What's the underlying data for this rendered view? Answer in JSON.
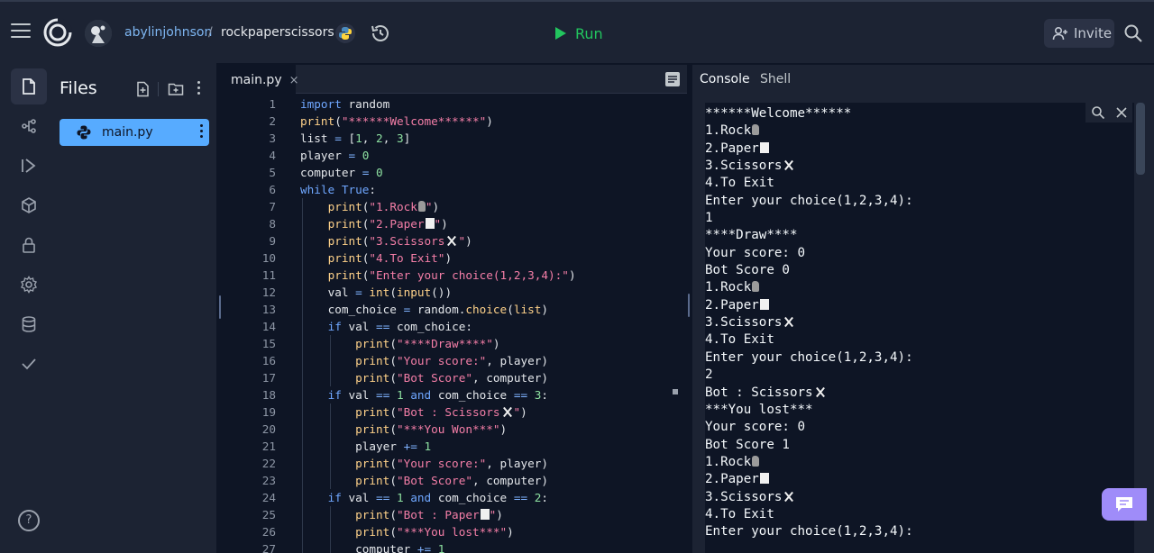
{
  "header": {
    "username": "abylinjohnson",
    "separator": "/",
    "repl_name": "rockpaperscissors",
    "run_label": "Run",
    "invite_label": "Invite"
  },
  "files_panel": {
    "title": "Files",
    "files": [
      {
        "name": "main.py"
      }
    ]
  },
  "editor": {
    "tab_label": "main.py",
    "tab_close": "×",
    "line_numbers": [
      "1",
      "2",
      "3",
      "4",
      "5",
      "6",
      "7",
      "8",
      "9",
      "10",
      "11",
      "12",
      "13",
      "14",
      "15",
      "16",
      "17",
      "18",
      "19",
      "20",
      "21",
      "22",
      "23",
      "24",
      "25",
      "26",
      "27"
    ],
    "lines": [
      "import random",
      "print(\"******Welcome******\")",
      "list = [1, 2, 3]",
      "player = 0",
      "computer = 0",
      "while True:",
      "    print(\"1.Rock\")",
      "    print(\"2.Paper\")",
      "    print(\"3.Scissors\")",
      "    print(\"4.To Exit\")",
      "    print(\"Enter your choice(1,2,3,4):\")",
      "    val = int(input())",
      "    com_choice = random.choice(list)",
      "    if val == com_choice:",
      "        print(\"****Draw****\")",
      "        print(\"Your score:\", player)",
      "        print(\"Bot Score\", computer)",
      "    if val == 1 and com_choice == 3:",
      "        print(\"Bot : Scissors\")",
      "        print(\"***You Won***\")",
      "        player += 1",
      "        print(\"Your score:\", player)",
      "        print(\"Bot Score\", computer)",
      "    if val == 1 and com_choice == 2:",
      "        print(\"Bot : Paper\")",
      "        print(\"***You lost***\")",
      "        computer += 1"
    ]
  },
  "console": {
    "tabs": [
      {
        "label": "Console",
        "active": true
      },
      {
        "label": "Shell",
        "active": false
      }
    ],
    "output": [
      {
        "text": "******Welcome******",
        "emoji": ""
      },
      {
        "text": "1.Rock",
        "emoji": "rock"
      },
      {
        "text": "2.Paper",
        "emoji": "paper"
      },
      {
        "text": "3.Scissors",
        "emoji": "scissors"
      },
      {
        "text": "4.To Exit",
        "emoji": ""
      },
      {
        "text": "Enter your choice(1,2,3,4):",
        "emoji": ""
      },
      {
        "text": "1",
        "emoji": ""
      },
      {
        "text": "****Draw****",
        "emoji": ""
      },
      {
        "text": "Your score: 0",
        "emoji": ""
      },
      {
        "text": "Bot Score 0",
        "emoji": ""
      },
      {
        "text": "1.Rock",
        "emoji": "rock"
      },
      {
        "text": "2.Paper",
        "emoji": "paper"
      },
      {
        "text": "3.Scissors",
        "emoji": "scissors"
      },
      {
        "text": "4.To Exit",
        "emoji": ""
      },
      {
        "text": "Enter your choice(1,2,3,4):",
        "emoji": ""
      },
      {
        "text": "2",
        "emoji": ""
      },
      {
        "text": "Bot : Scissors",
        "emoji": "scissors"
      },
      {
        "text": "***You lost***",
        "emoji": ""
      },
      {
        "text": "Your score: 0",
        "emoji": ""
      },
      {
        "text": "Bot Score 1",
        "emoji": ""
      },
      {
        "text": "1.Rock",
        "emoji": "rock"
      },
      {
        "text": "2.Paper",
        "emoji": "paper"
      },
      {
        "text": "3.Scissors",
        "emoji": "scissors"
      },
      {
        "text": "4.To Exit",
        "emoji": ""
      },
      {
        "text": "Enter your choice(1,2,3,4):",
        "emoji": ""
      }
    ]
  },
  "help_label": "?",
  "colors": {
    "accent_blue": "#57abff",
    "run_green": "#22c55e",
    "feedback_purple": "#9f8cf9",
    "background": "#0e1525",
    "surface": "#1c2333"
  },
  "icons": {
    "rail": [
      "files-icon",
      "git-icon",
      "debugger-icon",
      "packages-icon",
      "secrets-icon",
      "settings-icon",
      "database-icon",
      "check-icon"
    ]
  }
}
